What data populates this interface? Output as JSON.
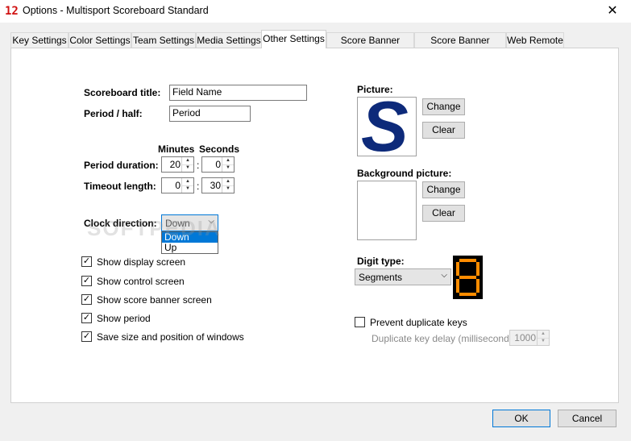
{
  "window": {
    "title": "Options - Multisport Scoreboard Standard",
    "close_glyph": "✕",
    "icon_glyph": "12"
  },
  "tabs": [
    {
      "label": "Key Settings"
    },
    {
      "label": "Color Settings"
    },
    {
      "label": "Team Settings"
    },
    {
      "label": "Media Settings"
    },
    {
      "label": "Other Settings",
      "active": true
    },
    {
      "label": "Score Banner Colors"
    },
    {
      "label": "Score Banner Display"
    },
    {
      "label": "Web Remote"
    }
  ],
  "form": {
    "scoreboard_title_label": "Scoreboard title:",
    "scoreboard_title_value": "Field Name",
    "period_half_label": "Period / half:",
    "period_half_value": "Period",
    "minutes_header": "Minutes",
    "seconds_header": "Seconds",
    "period_duration_label": "Period duration:",
    "period_duration_minutes": "20",
    "period_duration_seconds": "0",
    "timeout_length_label": "Timeout length:",
    "timeout_length_minutes": "0",
    "timeout_length_seconds": "30",
    "colon": ":",
    "clock_direction_label": "Clock direction:",
    "clock_direction_value": "Down",
    "clock_direction_options": [
      "Down",
      "Up"
    ]
  },
  "checkboxes": [
    {
      "label": "Show display screen",
      "checked": true
    },
    {
      "label": "Show control screen",
      "checked": true
    },
    {
      "label": "Show score banner screen",
      "checked": true
    },
    {
      "label": "Show period",
      "checked": true
    },
    {
      "label": "Save size and position of windows",
      "checked": true
    }
  ],
  "check_glyph": "✓",
  "picture": {
    "label": "Picture:",
    "change_label": "Change",
    "clear_label": "Clear",
    "logo_letter": "S",
    "logo_color": "#0d2a7a"
  },
  "background_picture": {
    "label": "Background picture:",
    "change_label": "Change",
    "clear_label": "Clear"
  },
  "digit_type": {
    "label": "Digit type:",
    "value": "Segments",
    "preview_digit": "8",
    "segment_color": "#ff8c00"
  },
  "duplicate_keys": {
    "prevent_label": "Prevent duplicate keys",
    "prevent_checked": false,
    "delay_label": "Duplicate key delay (milliseconds):",
    "delay_value": "1000"
  },
  "footer": {
    "ok_label": "OK",
    "cancel_label": "Cancel"
  },
  "watermark": "SOFTPEDIA"
}
